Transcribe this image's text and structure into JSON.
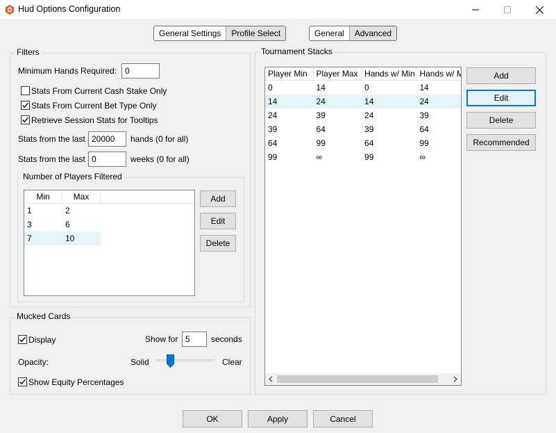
{
  "window": {
    "title": "Hud Options Configuration"
  },
  "tabs_left": [
    {
      "label": "General Settings",
      "active": false
    },
    {
      "label": "Profile Select",
      "active": true
    }
  ],
  "tabs_right": [
    {
      "label": "General",
      "active": false
    },
    {
      "label": "Advanced",
      "active": true
    }
  ],
  "filters": {
    "group_label": "Filters",
    "min_hands_label": "Minimum Hands Required:",
    "min_hands_value": "0",
    "checkboxes": [
      {
        "label": "Stats From Current Cash Stake Only",
        "checked": false
      },
      {
        "label": "Stats From Current Bet Type Only",
        "checked": true
      },
      {
        "label": "Retrieve Session Stats for Tooltips",
        "checked": true
      }
    ],
    "hands_prefix": "Stats from the last",
    "hands_value": "20000",
    "hands_suffix": "hands (0 for all)",
    "weeks_prefix": "Stats from the last",
    "weeks_value": "0",
    "weeks_suffix": "weeks (0 for all)"
  },
  "players_filtered": {
    "group_label": "Number of Players Filtered",
    "columns": [
      "Min",
      "Max"
    ],
    "rows": [
      {
        "min": "1",
        "max": "2",
        "selected": false
      },
      {
        "min": "3",
        "max": "6",
        "selected": false
      },
      {
        "min": "7",
        "max": "10",
        "selected": true
      }
    ],
    "add_label": "Add",
    "edit_label": "Edit",
    "delete_label": "Delete"
  },
  "mucked": {
    "group_label": "Mucked Cards",
    "display_label": "Display",
    "display_checked": true,
    "show_for_label": "Show for",
    "show_for_value": "5",
    "seconds_label": "seconds",
    "opacity_label": "Opacity:",
    "solid_label": "Solid",
    "clear_label": "Clear",
    "opacity_fraction": 0.24,
    "equity_label": "Show Equity Percentages",
    "equity_checked": true
  },
  "tournament": {
    "group_label": "Tournament Stacks",
    "columns": [
      "Player Min",
      "Player Max",
      "Hands w/ Min",
      "Hands w/ M"
    ],
    "rows": [
      {
        "cells": [
          "0",
          "14",
          "0",
          "14"
        ],
        "selected": false
      },
      {
        "cells": [
          "14",
          "24",
          "14",
          "24"
        ],
        "selected": true
      },
      {
        "cells": [
          "24",
          "39",
          "24",
          "39"
        ],
        "selected": false
      },
      {
        "cells": [
          "39",
          "64",
          "39",
          "64"
        ],
        "selected": false
      },
      {
        "cells": [
          "64",
          "99",
          "64",
          "99"
        ],
        "selected": false
      },
      {
        "cells": [
          "99",
          "∞",
          "99",
          "∞"
        ],
        "selected": false
      }
    ],
    "add_label": "Add",
    "edit_label": "Edit",
    "delete_label": "Delete",
    "recommended_label": "Recommended"
  },
  "footer": {
    "ok_label": "OK",
    "apply_label": "Apply",
    "cancel_label": "Cancel"
  },
  "colors": {
    "accent": "#0078d7",
    "selection": "#e5f3fb",
    "app_icon": "#e8561d"
  }
}
